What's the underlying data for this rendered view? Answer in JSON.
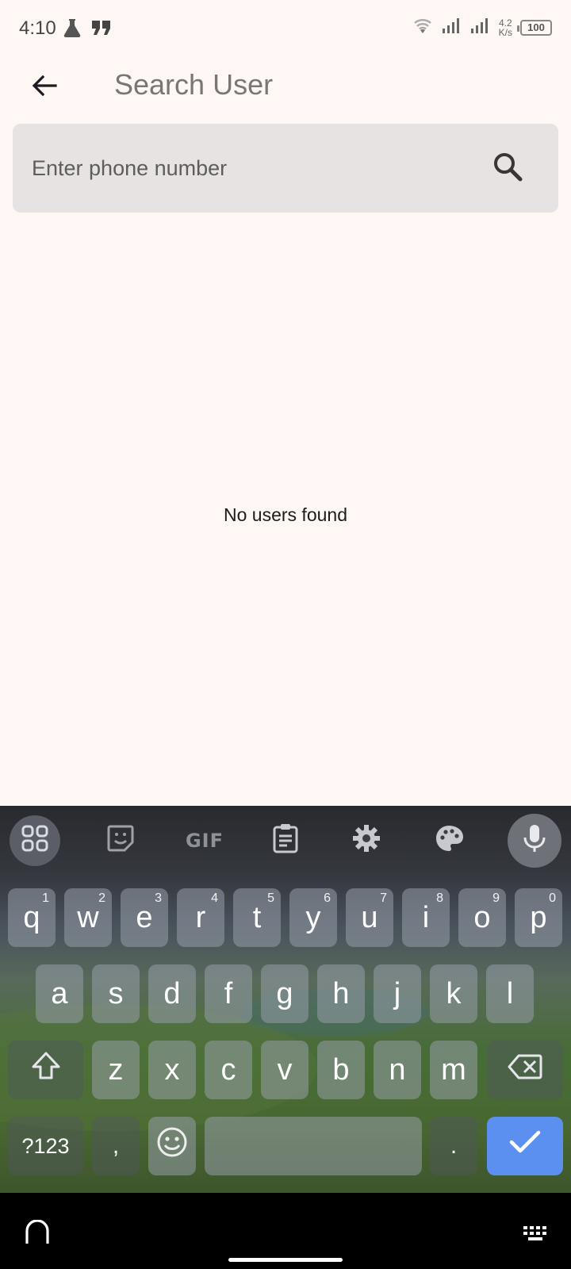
{
  "status_bar": {
    "time": "4:10",
    "net_speed_value": "4.2",
    "net_speed_unit": "K/s",
    "battery": "100"
  },
  "app_bar": {
    "title": "Search User"
  },
  "search": {
    "placeholder": "Enter phone number",
    "value": ""
  },
  "main": {
    "empty_message": "No users found"
  },
  "keyboard": {
    "toolbar": {
      "gif_label": "GIF"
    },
    "row1": [
      {
        "label": "q",
        "hint": "1"
      },
      {
        "label": "w",
        "hint": "2"
      },
      {
        "label": "e",
        "hint": "3"
      },
      {
        "label": "r",
        "hint": "4"
      },
      {
        "label": "t",
        "hint": "5"
      },
      {
        "label": "y",
        "hint": "6"
      },
      {
        "label": "u",
        "hint": "7"
      },
      {
        "label": "i",
        "hint": "8"
      },
      {
        "label": "o",
        "hint": "9"
      },
      {
        "label": "p",
        "hint": "0"
      }
    ],
    "row2": [
      "a",
      "s",
      "d",
      "f",
      "g",
      "h",
      "j",
      "k",
      "l"
    ],
    "row3": [
      "z",
      "x",
      "c",
      "v",
      "b",
      "n",
      "m"
    ],
    "symbols_label": "?123",
    "comma_label": ",",
    "period_label": ".",
    "colors": {
      "enter_key": "#5b8ff0"
    }
  },
  "theme": {
    "background": "#fff7f4",
    "search_background": "#e7e3e3"
  }
}
